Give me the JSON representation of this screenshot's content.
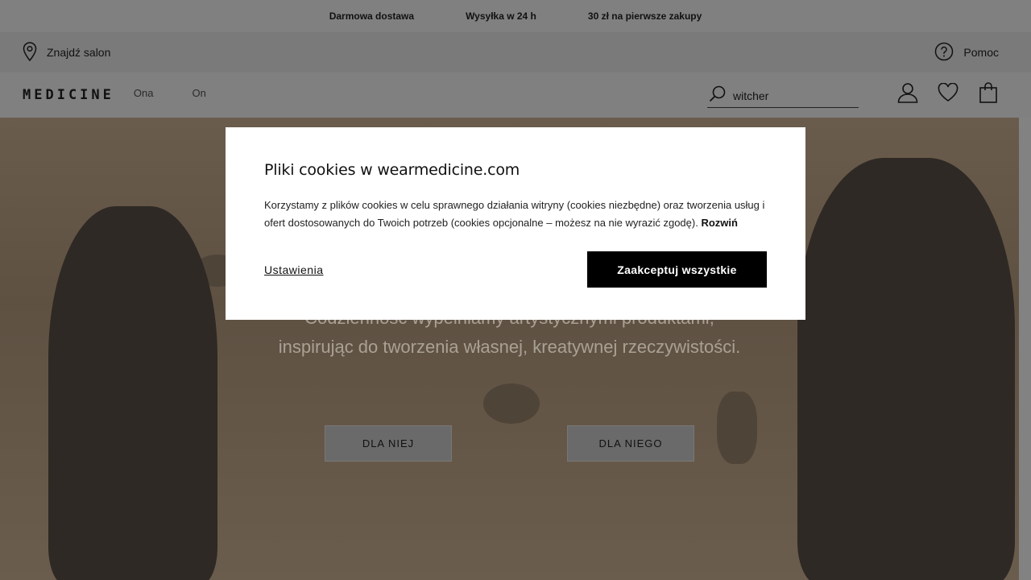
{
  "promo": [
    "Darmowa dostawa",
    "Wysyłka w 24 h",
    "30 zł na pierwsze zakupy"
  ],
  "util": {
    "find_store": "Znajdź salon",
    "help": "Pomoc"
  },
  "nav": {
    "logo": "MEDICINE",
    "links": [
      "Ona",
      "On"
    ]
  },
  "search": {
    "value": "witcher"
  },
  "icons": {
    "location": "map-pin-icon",
    "help": "question-circle-icon",
    "search": "search-icon",
    "account": "user-icon",
    "wishlist": "heart-icon",
    "cart": "bag-icon"
  },
  "hero": {
    "line1": "Codzienność wypełniamy artystycznymi produktami,",
    "line2": "inspirując do tworzenia własnej, kreatywnej rzeczywistości.",
    "btn_her": "DLA NIEJ",
    "btn_him": "DLA NIEGO"
  },
  "cookie": {
    "title": "Pliki cookies w wearmedicine.com",
    "text": "Korzystamy z plików cookies w celu sprawnego działania witryny (cookies niezbędne) oraz tworzenia usług i ofert dostosowanych do Twoich potrzeb (cookies opcjonalne – możesz na nie wyrazić zgodę).",
    "expand": "Rozwiń",
    "settings": "Ustawienia",
    "accept": "Zaakceptuj wszystkie"
  }
}
